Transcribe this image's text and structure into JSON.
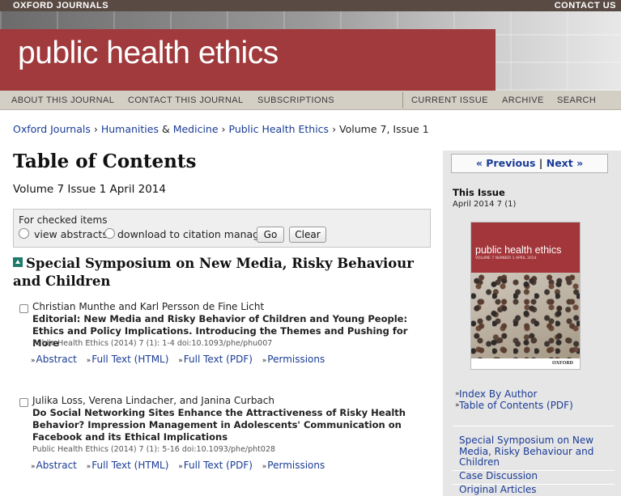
{
  "topbar": {
    "brand": "OXFORD JOURNALS",
    "contact": "CONTACT US"
  },
  "banner": {
    "title": "public health ethics"
  },
  "nav": {
    "left": [
      "ABOUT THIS JOURNAL",
      "CONTACT THIS JOURNAL",
      "SUBSCRIPTIONS"
    ],
    "right": [
      "CURRENT ISSUE",
      "ARCHIVE",
      "SEARCH"
    ]
  },
  "breadcrumb": {
    "oxford": "Oxford Journals",
    "humanities": "Humanities",
    "amp": "&",
    "medicine": "Medicine",
    "journal": "Public Health Ethics",
    "current": "Volume 7, Issue 1",
    "sep": "›"
  },
  "page": {
    "title": "Table of Contents",
    "volume": "Volume 7 Issue 1 April 2014"
  },
  "checked_items": {
    "label": "For checked items",
    "option1": "view abstracts",
    "option2": "download to citation manager",
    "go": "Go",
    "clear": "Clear"
  },
  "section": {
    "title": "Special Symposium on New Media, Risky Behaviour and Children"
  },
  "articles": [
    {
      "authors": "Christian Munthe and Karl Persson de Fine Licht",
      "title": "Editorial: New Media and Risky Behavior of Children and Young People: Ethics and Policy Implications. Introducing the Themes and Pushing for More",
      "citation": "Public Health Ethics (2014) 7 (1): 1-4 doi:10.1093/phe/phu007",
      "links": [
        "Abstract",
        "Full Text (HTML)",
        "Full Text (PDF)",
        "Permissions"
      ]
    },
    {
      "authors": "Julika Loss, Verena Lindacher, and Janina Curbach",
      "title": "Do Social Networking Sites Enhance the Attractiveness of Risky Health Behavior? Impression Management in Adolescents' Communication on Facebook and its Ethical Implications",
      "citation": "Public Health Ethics (2014) 7 (1): 5-16 doi:10.1093/phe/pht028",
      "links": [
        "Abstract",
        "Full Text (HTML)",
        "Full Text (PDF)",
        "Permissions"
      ]
    }
  ],
  "sidebar": {
    "previous": "« Previous",
    "sep": "|",
    "next": "Next »",
    "this_issue": "This Issue",
    "issue_date": "April 2014 7 (1)",
    "cover": {
      "title": "public health ethics",
      "subtitle": "VOLUME 7  NUMBER 1  APRIL 2014",
      "publisher": "OXFORD"
    },
    "links": [
      "Index By Author",
      "Table of Contents (PDF)"
    ],
    "sections": [
      "Special Symposium on New Media, Risky Behaviour and Children",
      "Case Discussion",
      "Original Articles"
    ]
  },
  "colors": {
    "accent_red": "#a03a3c",
    "link_blue": "#1a3c96",
    "nav_bg": "#d4cfc5",
    "sidebar_bg": "#e6e6e6"
  },
  "icons": {
    "section_toggle": "collapse-triangle-icon",
    "link_bullet": "right-chevron-icon"
  }
}
